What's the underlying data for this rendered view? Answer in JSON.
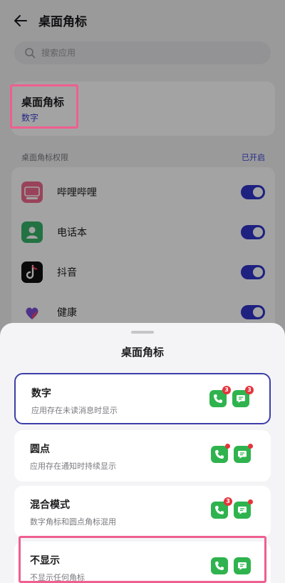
{
  "header": {
    "title": "桌面角标"
  },
  "search": {
    "placeholder": "搜索应用"
  },
  "badge_setting": {
    "title": "桌面角标",
    "value": "数字"
  },
  "permissions": {
    "label": "桌面角标权限",
    "status": "已开启",
    "apps": [
      {
        "name": "哔哩哔哩",
        "icon": "bilibili-icon",
        "enabled": true
      },
      {
        "name": "电话本",
        "icon": "contacts-icon",
        "enabled": true
      },
      {
        "name": "抖音",
        "icon": "douyin-icon",
        "enabled": true
      },
      {
        "name": "健康",
        "icon": "health-icon",
        "enabled": true
      }
    ]
  },
  "sheet": {
    "title": "桌面角标",
    "options": [
      {
        "title": "数字",
        "desc": "应用存在未读消息时显示",
        "selected": true,
        "badge": "3"
      },
      {
        "title": "圆点",
        "desc": "应用存在通知时持续显示",
        "selected": false
      },
      {
        "title": "混合模式",
        "desc": "数字角标和圆点角标混用",
        "selected": false,
        "badge": "3"
      },
      {
        "title": "不显示",
        "desc": "不显示任何角标",
        "selected": false
      }
    ]
  },
  "colors": {
    "accent": "#3a3fd0",
    "highlight": "#ef5f8f",
    "badge_red": "#e5343d",
    "app_green": "#2fb34e"
  }
}
